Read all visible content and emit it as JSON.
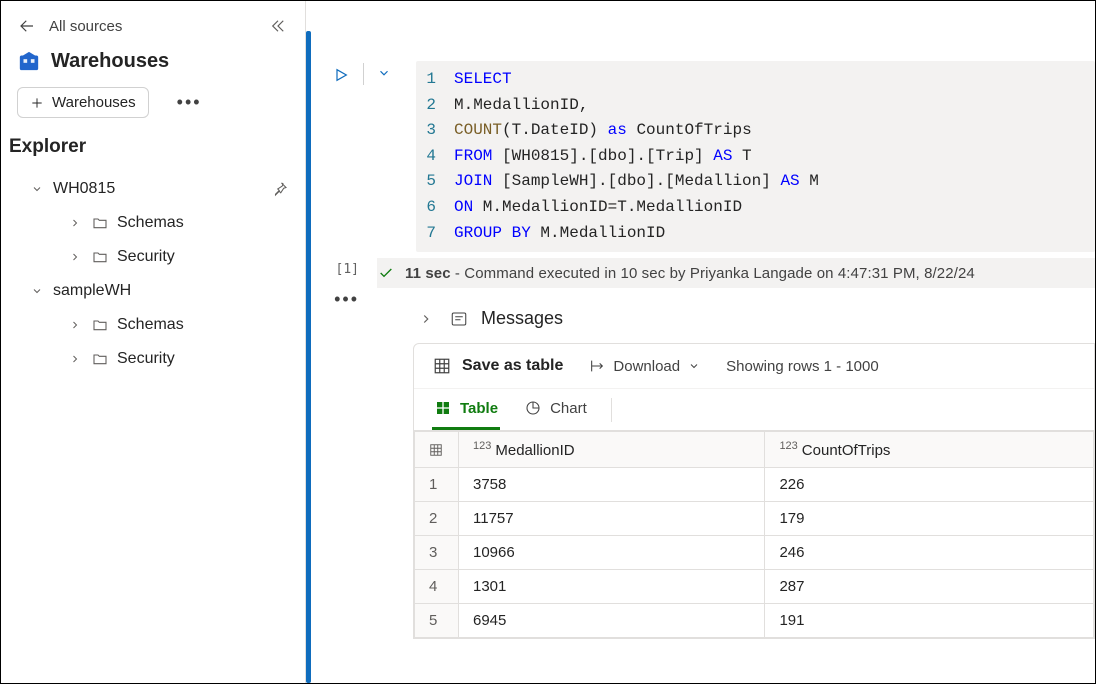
{
  "sidebar": {
    "back_label": "All sources",
    "title": "Warehouses",
    "add_button": "Warehouses",
    "explorer_label": "Explorer",
    "tree": [
      {
        "name": "WH0815",
        "children": [
          "Schemas",
          "Security"
        ]
      },
      {
        "name": "sampleWH",
        "children": [
          "Schemas",
          "Security"
        ]
      }
    ]
  },
  "editor": {
    "lines": [
      {
        "n": 1,
        "parts": [
          {
            "t": "SELECT",
            "c": "kw"
          }
        ]
      },
      {
        "n": 2,
        "parts": [
          {
            "t": "M.MedallionID,",
            "c": ""
          }
        ]
      },
      {
        "n": 3,
        "parts": [
          {
            "t": "COUNT",
            "c": "fn"
          },
          {
            "t": "(T.DateID) ",
            "c": ""
          },
          {
            "t": "as",
            "c": "kw"
          },
          {
            "t": " CountOfTrips",
            "c": ""
          }
        ]
      },
      {
        "n": 4,
        "parts": [
          {
            "t": "FROM",
            "c": "kw"
          },
          {
            "t": " [WH0815].[dbo].[Trip] ",
            "c": ""
          },
          {
            "t": "AS",
            "c": "kw"
          },
          {
            "t": " T",
            "c": ""
          }
        ]
      },
      {
        "n": 5,
        "parts": [
          {
            "t": "JOIN",
            "c": "kw"
          },
          {
            "t": " [SampleWH].[dbo].[Medallion] ",
            "c": ""
          },
          {
            "t": "AS",
            "c": "kw"
          },
          {
            "t": " M",
            "c": ""
          }
        ]
      },
      {
        "n": 6,
        "parts": [
          {
            "t": "ON",
            "c": "kw"
          },
          {
            "t": " M.MedallionID=T.MedallionID",
            "c": ""
          }
        ]
      },
      {
        "n": 7,
        "parts": [
          {
            "t": "GROUP BY",
            "c": "kw"
          },
          {
            "t": " M.MedallionID",
            "c": ""
          }
        ]
      }
    ],
    "cell_marker": "[1]",
    "status_time": "11 sec",
    "status_text": " - Command executed in 10 sec by Priyanka Langade on 4:47:31 PM, 8/22/24"
  },
  "messages": {
    "label": "Messages"
  },
  "results": {
    "save_label": "Save as table",
    "download_label": "Download",
    "showing_label": "Showing rows 1 - 1000",
    "tabs": {
      "table": "Table",
      "chart": "Chart"
    },
    "columns": [
      "MedallionID",
      "CountOfTrips"
    ],
    "col_type_prefix": "123",
    "rows": [
      [
        "3758",
        "226"
      ],
      [
        "11757",
        "179"
      ],
      [
        "10966",
        "246"
      ],
      [
        "1301",
        "287"
      ],
      [
        "6945",
        "191"
      ]
    ]
  }
}
